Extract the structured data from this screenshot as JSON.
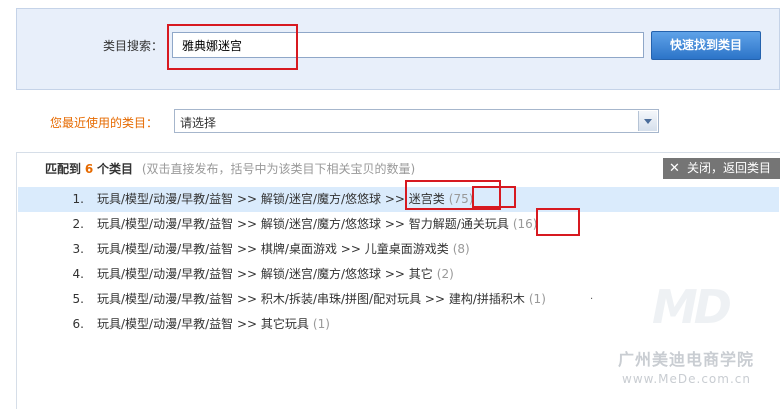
{
  "search": {
    "label": "类目搜索：",
    "value": "雅典娜迷宫",
    "button_label": "快速找到类目"
  },
  "recent": {
    "label": "您最近使用的类目：",
    "selected": "请选择"
  },
  "results": {
    "match_prefix": "匹配到",
    "match_count": "6",
    "match_suffix": "个类目",
    "hint": "(双击直接发布，括号中为该类目下相关宝贝的数量)",
    "close_label": "关闭，返回类目",
    "rows": [
      {
        "num": "1.",
        "path": "玩具/模型/动漫/早教/益智 >> 解锁/迷宫/魔方/悠悠球 >> 迷宫类",
        "count": "(75)",
        "selected": true
      },
      {
        "num": "2.",
        "path": "玩具/模型/动漫/早教/益智 >> 解锁/迷宫/魔方/悠悠球 >> 智力解题/通关玩具",
        "count": "(16)",
        "selected": false
      },
      {
        "num": "3.",
        "path": "玩具/模型/动漫/早教/益智 >> 棋牌/桌面游戏 >> 儿童桌面游戏类",
        "count": "(8)",
        "selected": false
      },
      {
        "num": "4.",
        "path": "玩具/模型/动漫/早教/益智 >> 解锁/迷宫/魔方/悠悠球 >> 其它",
        "count": "(2)",
        "selected": false
      },
      {
        "num": "5.",
        "path": "玩具/模型/动漫/早教/益智 >> 积木/拆装/串珠/拼图/配对玩具 >> 建构/拼插积木",
        "count": "(1)",
        "selected": false
      },
      {
        "num": "6.",
        "path": "玩具/模型/动漫/早教/益智 >> 其它玩具",
        "count": "(1)",
        "selected": false
      }
    ]
  },
  "watermark": {
    "logo": "MD",
    "name": "广州美迪电商学院",
    "url": "www.MeDe.com.cn"
  },
  "colors": {
    "panel_bg": "#e8effa",
    "accent_orange": "#e66a00",
    "button_blue": "#2c74c8",
    "selected_row": "#daebfc",
    "annotation_red": "#d71920"
  }
}
